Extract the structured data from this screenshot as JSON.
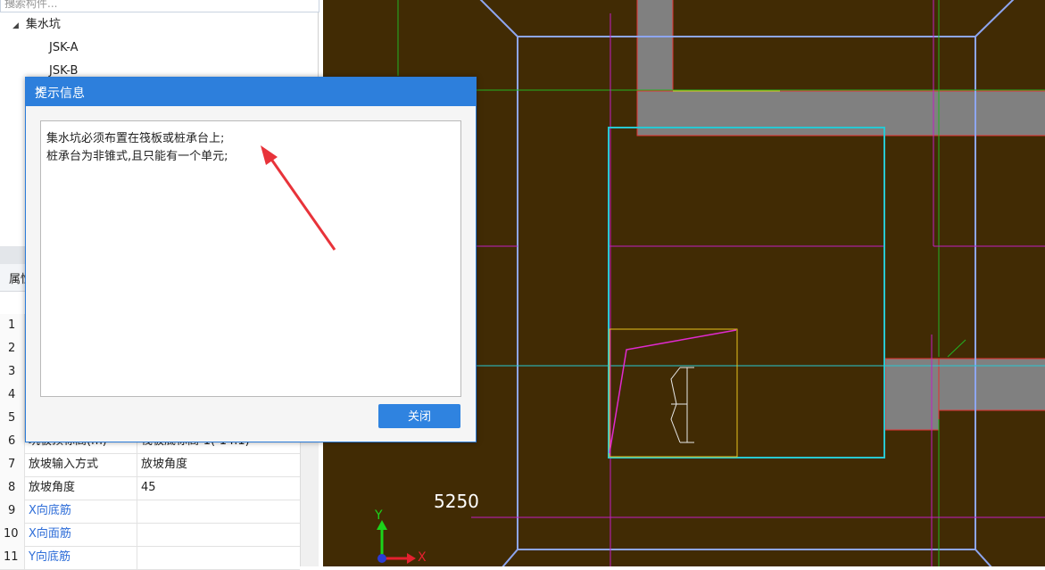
{
  "search": {
    "placeholder": "搜索构件..."
  },
  "tree": {
    "group_label": "集水坑",
    "items": [
      "JSK-A",
      "JSK-B"
    ]
  },
  "properties": {
    "header": "属性",
    "rows": [
      {
        "num": "1",
        "name": "",
        "value": ""
      },
      {
        "num": "2",
        "name": "",
        "value": ""
      },
      {
        "num": "3",
        "name": "",
        "value": ""
      },
      {
        "num": "4",
        "name": "",
        "value": ""
      },
      {
        "num": "5",
        "name": "",
        "value": ""
      },
      {
        "num": "6",
        "name": "坑板顶标高(m)",
        "value": "筏板底标高-1(-14.1)"
      },
      {
        "num": "7",
        "name": "放坡输入方式",
        "value": "放坡角度"
      },
      {
        "num": "8",
        "name": "放坡角度",
        "value": "45"
      },
      {
        "num": "9",
        "name": "X向底筋",
        "value": ""
      },
      {
        "num": "10",
        "name": "X向面筋",
        "value": ""
      },
      {
        "num": "11",
        "name": "Y向底筋",
        "value": ""
      }
    ]
  },
  "canvas": {
    "dimension_label": "5250",
    "axis_x": "X",
    "axis_y": "Y"
  },
  "dialog": {
    "title": "提示信息",
    "close_icon": "×",
    "message_line1": "集水坑必须布置在筏板或桩承台上;",
    "message_line2": "桩承台为非锥式,且只能有一个单元;",
    "close_button": "关闭"
  },
  "colors": {
    "canvas_bg": "#412b04",
    "dialog_title_bg": "#2d7fdc",
    "annotation_arrow": "#e8333a"
  }
}
